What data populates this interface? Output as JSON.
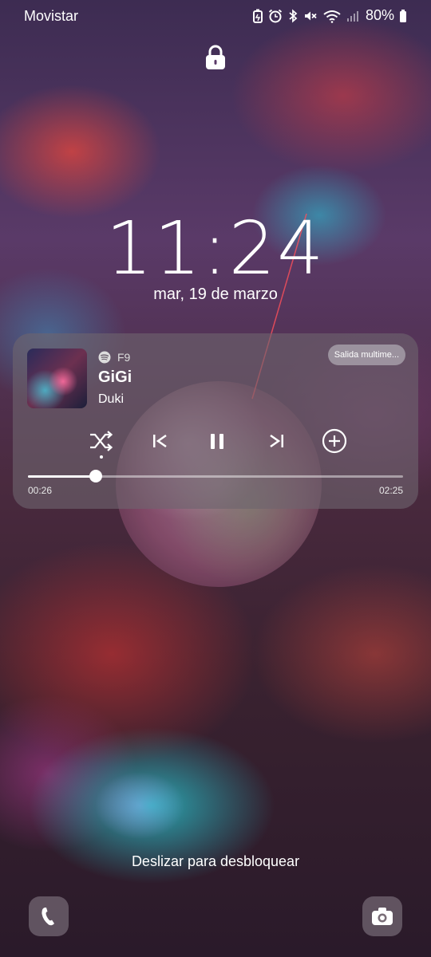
{
  "status_bar": {
    "carrier": "Movistar",
    "battery": "80%",
    "icons": [
      "battery-saver-icon",
      "alarm-icon",
      "bluetooth-icon",
      "mute-icon",
      "wifi-icon",
      "signal-icon",
      "battery-icon"
    ]
  },
  "lock": {
    "icon": "lock-icon"
  },
  "clock": {
    "time": "11:24",
    "date": "mar, 19 de marzo"
  },
  "media": {
    "app_icon": "spotify-icon",
    "device": "F9",
    "title": "GiGi",
    "artist": "Duki",
    "output_button": "Salida multime...",
    "elapsed": "00:26",
    "duration": "02:25",
    "progress": 0.18,
    "controls": [
      "shuffle-icon",
      "previous-icon",
      "pause-icon",
      "next-icon",
      "add-icon"
    ]
  },
  "unlock_hint": "Deslizar para desbloquear",
  "shortcuts": {
    "left": "phone-icon",
    "right": "camera-icon"
  }
}
